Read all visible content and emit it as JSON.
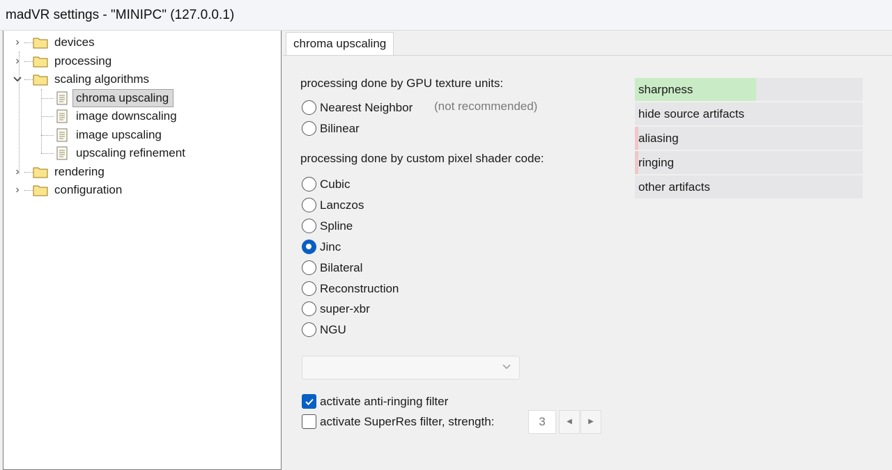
{
  "window": {
    "title": "madVR settings - \"MINIPC\" (127.0.0.1)"
  },
  "tree": {
    "devices": "devices",
    "processing": "processing",
    "scaling_algorithms": "scaling algorithms",
    "chroma_upscaling": "chroma upscaling",
    "image_downscaling": "image downscaling",
    "image_upscaling": "image upscaling",
    "upscaling_refinement": "upscaling refinement",
    "rendering": "rendering",
    "configuration": "configuration"
  },
  "tab": {
    "label": "chroma upscaling"
  },
  "gpu_section": {
    "label": "processing done by GPU texture units:",
    "options": [
      "Nearest Neighbor",
      "Bilinear"
    ],
    "note": "(not recommended)"
  },
  "shader_section": {
    "label": "processing done by custom pixel shader code:",
    "options": [
      "Cubic",
      "Lanczos",
      "Spline",
      "Jinc",
      "Bilateral",
      "Reconstruction",
      "super-xbr",
      "NGU"
    ],
    "selected": "Jinc"
  },
  "dropdown": {
    "value": ""
  },
  "antiringing": {
    "label": "activate anti-ringing filter",
    "checked": true
  },
  "superres": {
    "label": "activate SuperRes filter, strength:",
    "checked": false,
    "strength": "3"
  },
  "quality": {
    "sharpness": "sharpness",
    "hide_source_artifacts": "hide source artifacts",
    "aliasing": "aliasing",
    "ringing": "ringing",
    "other_artifacts": "other artifacts"
  },
  "colors": {
    "accent": "#0a5fc4",
    "sharpness_fill": "#c9ecc6",
    "artifact_fill": "#f1c7c9",
    "row_bg": "#e6e6e8"
  }
}
